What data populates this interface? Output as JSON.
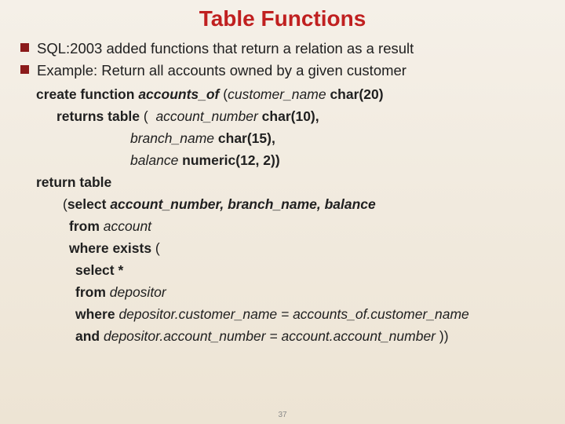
{
  "title": "Table Functions",
  "bullets": [
    "SQL:2003 added functions that return a relation as a result",
    "Example: Return all accounts owned by a given customer"
  ],
  "code": {
    "l1a": "create function ",
    "l1b": "accounts_of ",
    "l1c": "(",
    "l1d": "customer_name ",
    "l1e": "char(20)",
    "l2a": "returns table ",
    "l2b": "(  ",
    "l2c": "account_number ",
    "l2d": "char(10),",
    "l3a": "branch_name ",
    "l3b": "char(15),",
    "l4a": "balance ",
    "l4b": "numeric(12, 2))",
    "l5": "return table",
    "l6a": "(",
    "l6b": "select ",
    "l6c": "account_number, branch_name, balance",
    "l7a": "from ",
    "l7b": "account",
    "l8a": "where exists ",
    "l8b": "(",
    "l9": "select *",
    "l10a": "from ",
    "l10b": "depositor",
    "l11a": "where ",
    "l11b": "depositor.customer_name = accounts_of.customer_name",
    "l12a": "and ",
    "l12b": "depositor.account_number = account.account_number ",
    "l12c": "))"
  },
  "slide_number": "37"
}
